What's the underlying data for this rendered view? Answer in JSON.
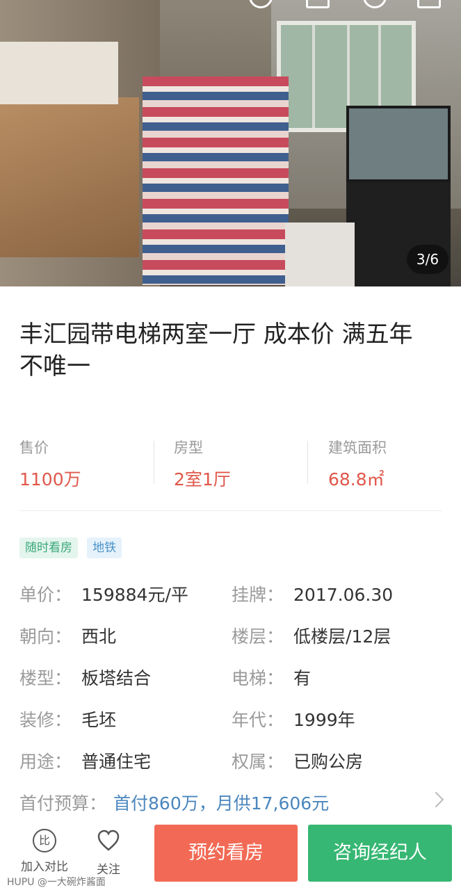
{
  "photo": {
    "counter": "3/6"
  },
  "title": "丰汇园带电梯两室一厅  成本价 满五年 不唯一",
  "stats": [
    {
      "label": "售价",
      "value": "1100万"
    },
    {
      "label": "房型",
      "value": "2室1厅"
    },
    {
      "label": "建筑面积",
      "value": "68.8㎡"
    }
  ],
  "tags": [
    "随时看房",
    "地铁"
  ],
  "details": [
    {
      "k1": "单价：",
      "v1": "159884元/平",
      "k2": "挂牌：",
      "v2": "2017.06.30"
    },
    {
      "k1": "朝向：",
      "v1": "西北",
      "k2": "楼层：",
      "v2": "低楼层/12层"
    },
    {
      "k1": "楼型：",
      "v1": "板塔结合",
      "k2": "电梯：",
      "v2": "有"
    },
    {
      "k1": "装修：",
      "v1": "毛坯",
      "k2": "年代：",
      "v2": "1999年"
    },
    {
      "k1": "用途：",
      "v1": "普通住宅",
      "k2": "权属：",
      "v2": "已购公房"
    }
  ],
  "payment": {
    "label": "首付预算：",
    "value": "首付860万，月供17,606元"
  },
  "bottom": {
    "compare_icon_text": "比",
    "compare": "加入对比",
    "follow": "关注",
    "book": "预约看房",
    "consult": "咨询经纪人"
  },
  "watermark": "HUPU @一大碗炸酱面",
  "colors": {
    "price": "#e0574a",
    "book": "#f26a55",
    "consult": "#36b773",
    "link": "#4a86bd"
  }
}
